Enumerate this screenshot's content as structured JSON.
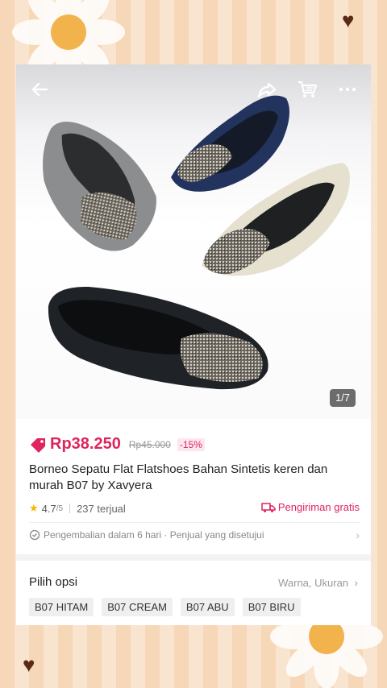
{
  "counter": "1/7",
  "price": {
    "current": "Rp38.250",
    "original": "Rp45.000",
    "discount": "-15%"
  },
  "product": {
    "title": "Borneo Sepatu Flat Flatshoes Bahan Sintetis keren dan murah B07 by Xavyera",
    "rating": "4.7",
    "rating_max": "/5",
    "sold": "237 terjual",
    "shipping": "Pengiriman gratis",
    "return_policy": "Pengembalian dalam 6 hari · Penjual yang disetujui"
  },
  "options": {
    "heading": "Pilih opsi",
    "summary": "Warna, Ukuran",
    "chips": [
      "B07 HITAM",
      "B07 CREAM",
      "B07 ABU",
      "B07 BIRU"
    ]
  },
  "shoe_brand": "Xavyera",
  "icons": [
    "back-arrow-icon",
    "share-icon",
    "cart-icon",
    "more-icon",
    "tag-icon",
    "star-icon",
    "truck-icon",
    "shield-check-icon",
    "chevron-right-icon"
  ],
  "colors": {
    "accent": "#e0245e",
    "frame": "#f6d9bd",
    "heart": "#5a2a17"
  }
}
